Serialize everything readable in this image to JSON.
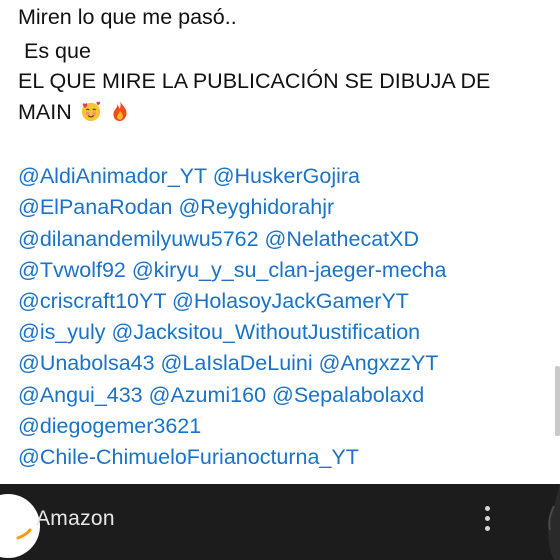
{
  "post": {
    "lines": [
      "Miren lo que me pasó..",
      " Es que",
      "EL QUE MIRE LA PUBLICACIÓN SE DIBUJA DE",
      "MAIN"
    ],
    "emojis": [
      "smiling-face-with-hearts",
      "fire"
    ],
    "mention_lines": [
      "@AldiAnimador_YT @HuskerGojira",
      "@ElPanaRodan @Reyghidorahjr",
      "@dilanandemilyuwu5762 @NelathecatXD",
      "@Tvwolf92 @kiryu_y_su_clan-jaeger-mecha",
      "@criscraft10YT @HolasoyJackGamerYT",
      "@is_yuly @Jacksitou_WithoutJustification",
      "@Unabolsa43 @LaIslaDeLuini @AngxzzYT",
      "@Angui_433 @Azumi160 @Sepalabolaxd",
      "@diegogemer3621",
      "@Chile-ChimueloFurianocturna_YT"
    ],
    "colors": {
      "text": "#111111",
      "mention": "#1a73c8"
    }
  },
  "app_bar": {
    "app_name": "Amazon",
    "menu_icon": "more-vert-icon",
    "background": "#1c1c1c"
  }
}
